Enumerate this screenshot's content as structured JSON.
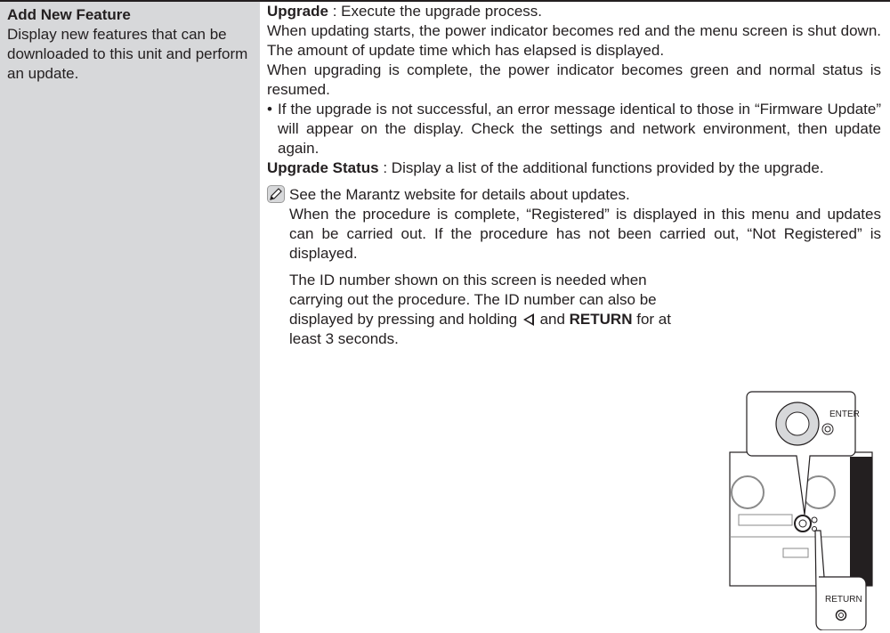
{
  "left": {
    "title": "Add New Feature",
    "description": "Display new features that can be downloaded to this unit and perform an update."
  },
  "upgrade": {
    "label": "Upgrade",
    "text": " : Execute the upgrade process.",
    "p1": "When updating starts, the power indicator becomes red and the menu screen is shut down. The amount of update time which has elapsed is displayed.",
    "p2": "When upgrading is complete, the power indicator becomes green and normal status is resumed.",
    "bullet": "If the upgrade is not successful, an error message identical to those in “Firmware Update” will appear on the display. Check the settings and network environment, then update again."
  },
  "status": {
    "label": "Upgrade Status",
    "text": " : Display a list of the additional functions provided by the upgrade."
  },
  "note": {
    "line1": "See the Marantz website for details about updates.",
    "line2": "When the procedure is complete, “Registered” is displayed in this menu and updates can be carried out. If the procedure has not been carried out, “Not Registered” is displayed.",
    "id_pre": "The ID number shown on this screen is needed when carrying out the procedure. The ID number can also be displayed by pressing and holding ",
    "id_and": " and ",
    "return_bold": "RETURN",
    "id_post": " for at least 3 seconds."
  },
  "figure": {
    "enter_label": "ENTER",
    "return_label": "RETURN"
  }
}
